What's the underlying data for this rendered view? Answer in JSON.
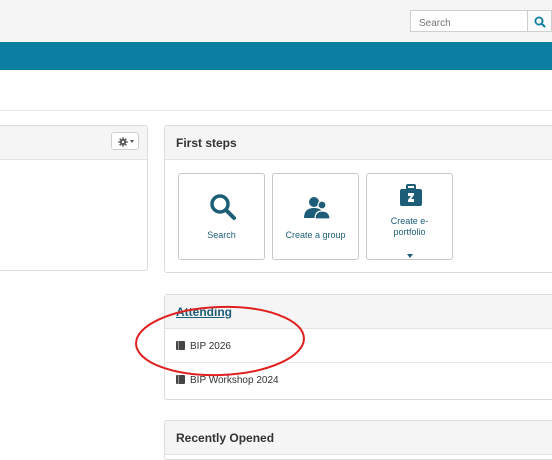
{
  "header": {
    "search_placeholder": "Search",
    "accent_color": "#0b7ea1"
  },
  "first_steps": {
    "title": "First steps",
    "tiles": [
      {
        "label": "Search",
        "icon": "magnifier-icon"
      },
      {
        "label": "Create a group",
        "icon": "group-icon"
      },
      {
        "label_line1": "Create e-",
        "label_line2": "portfolio",
        "icon": "portfolio-icon",
        "has_dropdown": true
      }
    ]
  },
  "attending": {
    "title": "Attending",
    "items": [
      "BIP 2026",
      "BIP Workshop 2024"
    ]
  },
  "recently_opened": {
    "title": "Recently Opened"
  },
  "annotation": {
    "shape": "ellipse",
    "color": "#e02020"
  }
}
